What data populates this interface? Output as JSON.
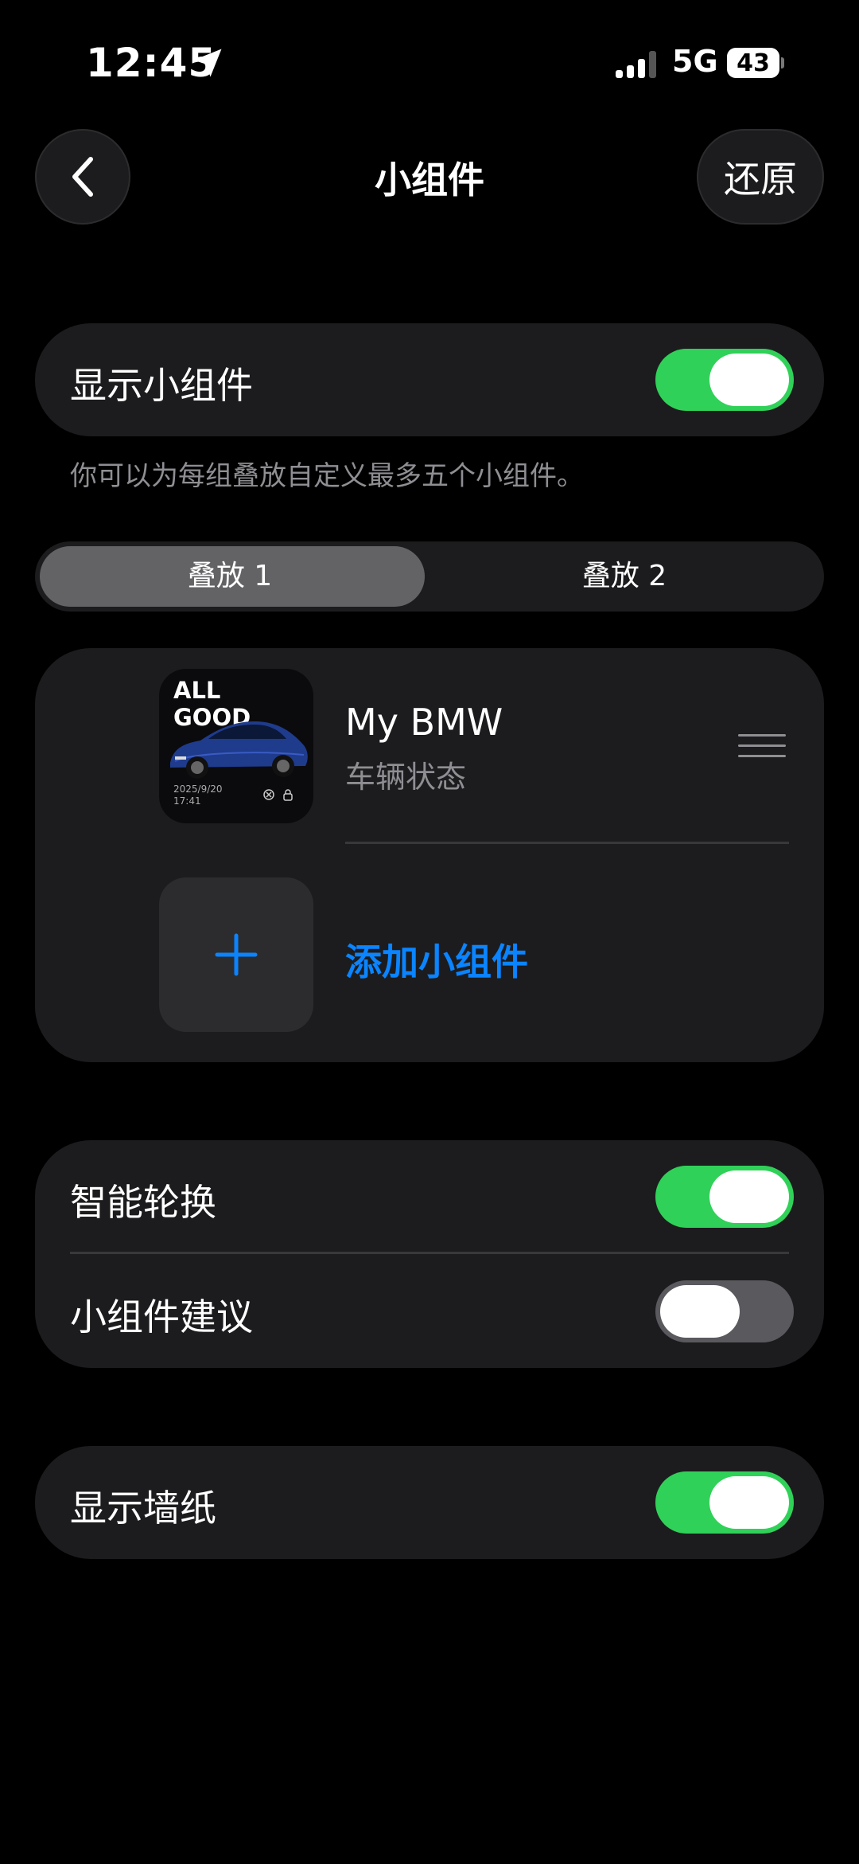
{
  "status_bar": {
    "time": "12:45",
    "network": "5G",
    "battery": "43"
  },
  "nav": {
    "title": "小组件",
    "restore_label": "还原"
  },
  "show_widgets": {
    "label": "显示小组件",
    "enabled": true
  },
  "hint": "你可以为每组叠放自定义最多五个小组件。",
  "stack_tabs": [
    {
      "label": "叠放 1",
      "selected": true
    },
    {
      "label": "叠放 2",
      "selected": false
    }
  ],
  "widget": {
    "name": "My BMW",
    "subtitle": "车辆状态",
    "thumb_title_line1": "ALL",
    "thumb_title_line2": "GOOD",
    "thumb_date": "2025/9/20",
    "thumb_time": "17:41"
  },
  "add_widget": {
    "label": "添加小组件"
  },
  "smart_rotate": {
    "label": "智能轮换",
    "enabled": true
  },
  "widget_suggestions": {
    "label": "小组件建议",
    "enabled": false
  },
  "show_wallpaper": {
    "label": "显示墙纸",
    "enabled": true
  },
  "colors": {
    "accent": "#0a84ff",
    "toggle_on": "#30d158",
    "card": "#1c1c1e"
  }
}
